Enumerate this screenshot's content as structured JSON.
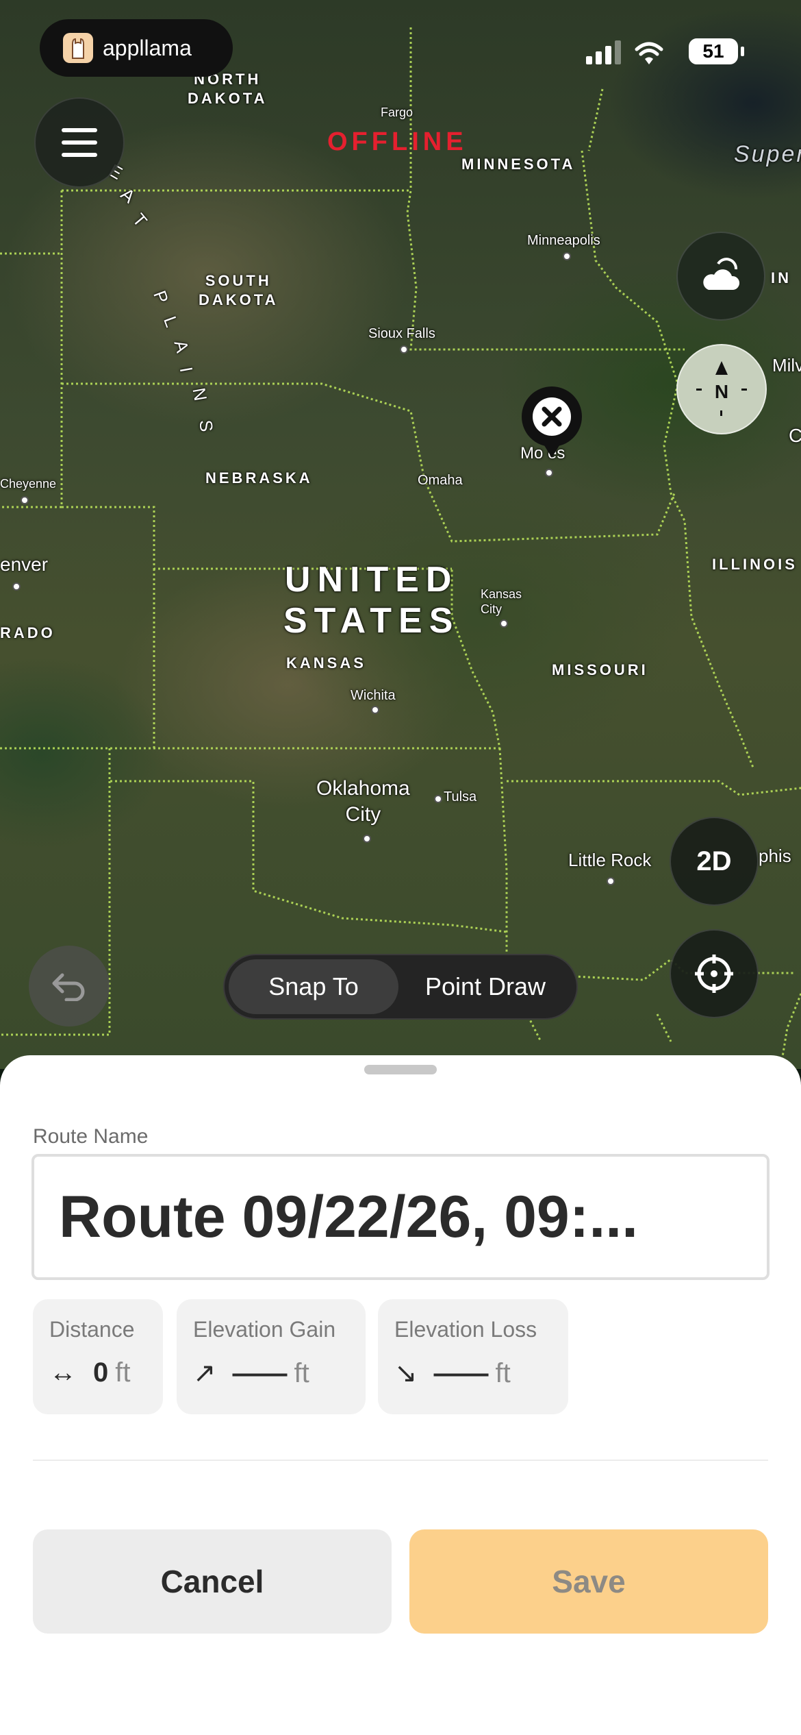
{
  "status_bar": {
    "app_name": "appllama",
    "battery": "51"
  },
  "map": {
    "offline_label": "OFFLINE",
    "country": {
      "line1": "UNITED",
      "line2": "STATES"
    },
    "states": {
      "north_dakota": [
        "NORTH",
        "DAKOTA"
      ],
      "south_dakota": [
        "SOUTH",
        "DAKOTA"
      ],
      "minnesota": "MINNESOTA",
      "nebraska": "NEBRASKA",
      "kansas": "KANSAS",
      "missouri": "MISSOURI",
      "illinois": "ILLINOIS",
      "colorado_partial": "RADO",
      "wisconsin_partial": "IN",
      "superior_partial": "Super"
    },
    "region": {
      "plains_letters": [
        "E",
        "A",
        "T",
        "P",
        "L",
        "A",
        "I",
        "N",
        "S"
      ]
    },
    "cities": {
      "fargo": "Fargo",
      "minneapolis": "Minneapolis",
      "sioux_falls": "Sioux Falls",
      "omaha": "Omaha",
      "des_moines_partial": "Mo    es",
      "cheyenne": "Cheyenne",
      "denver_partial": "enver",
      "kansas_city": [
        "Kansas",
        "City"
      ],
      "wichita": "Wichita",
      "oklahoma_city": [
        "Oklahoma",
        "City"
      ],
      "tulsa": "Tulsa",
      "little_rock": "Little Rock",
      "memphis_partial": "phis",
      "milwaukee_partial": "Milv",
      "chicago_partial": "C"
    },
    "controls": {
      "compass_label": "N",
      "view_mode": "2D",
      "segmented": {
        "option_1": "Snap To",
        "option_2": "Point Draw",
        "selected": "Snap To"
      }
    }
  },
  "sheet": {
    "route_name_label": "Route Name",
    "route_name_value": "Route 09/22/26, 09:...",
    "stats": [
      {
        "title": "Distance",
        "icon": "↔",
        "value": "0",
        "unit": "ft"
      },
      {
        "title": "Elevation Gain",
        "icon": "↗",
        "value": "——",
        "unit": "ft"
      },
      {
        "title": "Elevation Loss",
        "icon": "↘",
        "value": "——",
        "unit": "ft"
      }
    ],
    "cancel_label": "Cancel",
    "save_label": "Save"
  }
}
